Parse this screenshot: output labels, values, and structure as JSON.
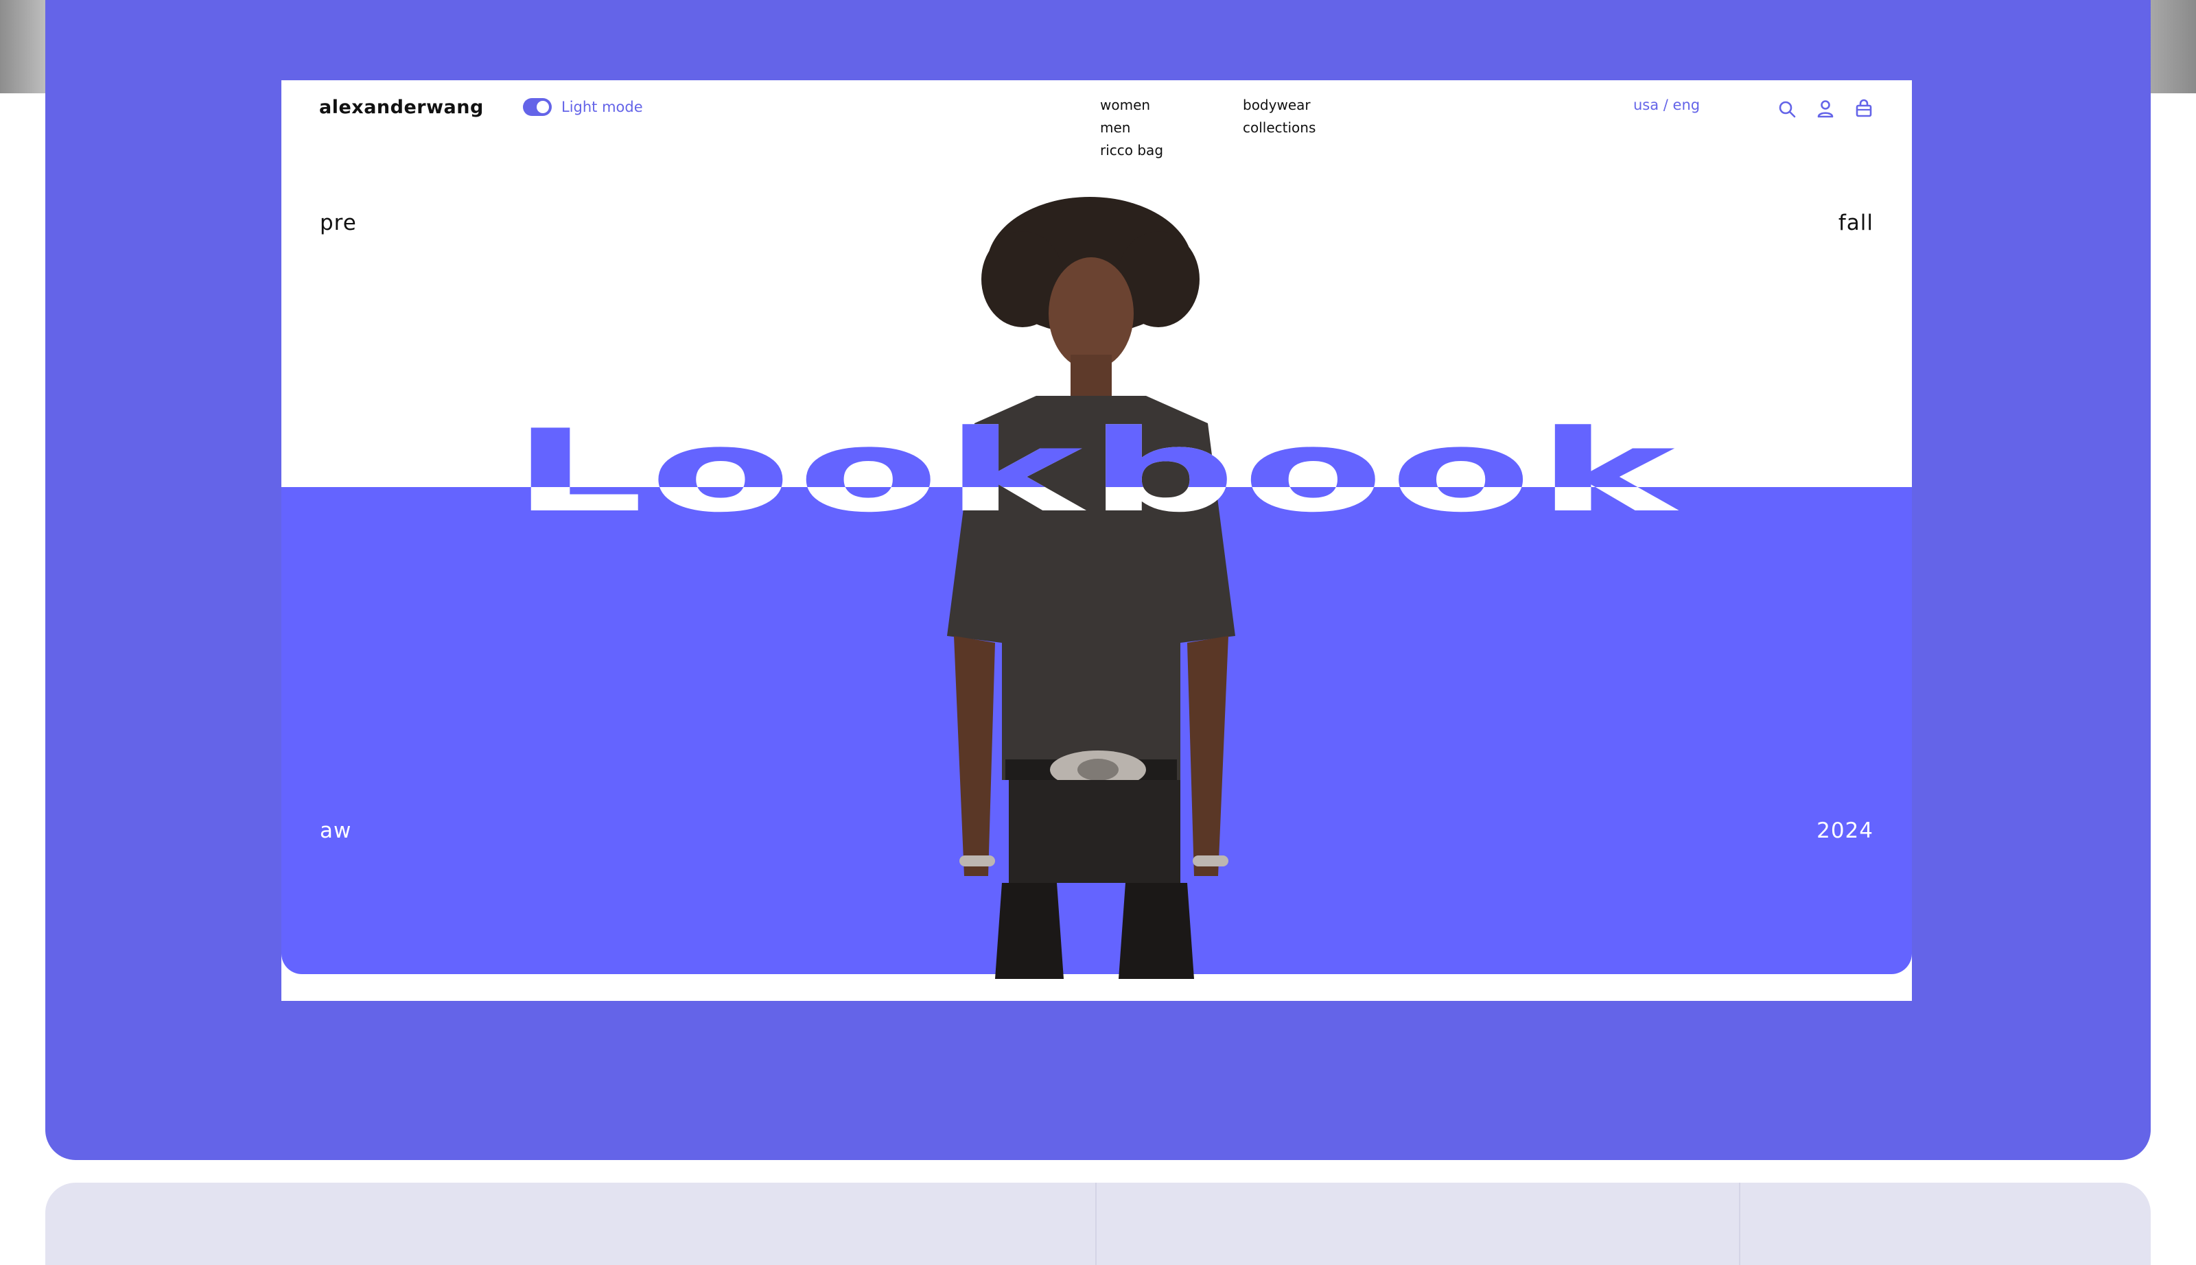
{
  "brand": {
    "logo_text": "alexanderwang",
    "accent_color": "#6464e8",
    "panel_color": "#6464ff"
  },
  "header": {
    "theme_toggle": {
      "label": "Light mode",
      "state": "on"
    },
    "nav": [
      {
        "label": "women"
      },
      {
        "label": "bodywear"
      },
      {
        "label": "men"
      },
      {
        "label": "collections"
      },
      {
        "label": "ricco bag"
      }
    ],
    "locale": "usa / eng",
    "icons": [
      "search-icon",
      "account-icon",
      "bag-icon"
    ]
  },
  "hero": {
    "title": "Lookbook",
    "top_left": "pre",
    "top_right": "fall",
    "bottom_left": "aw",
    "bottom_right": "2024"
  }
}
